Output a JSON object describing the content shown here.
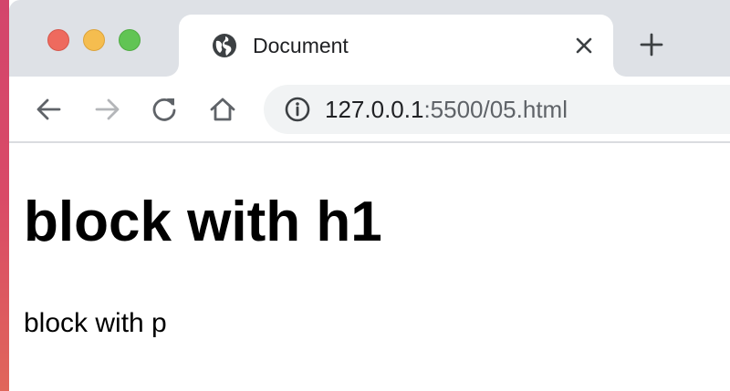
{
  "tab": {
    "title": "Document",
    "favicon": "globe-icon"
  },
  "toolbar": {
    "back_icon": "arrow-left-icon",
    "forward_icon": "arrow-right-icon",
    "reload_icon": "reload-icon",
    "home_icon": "home-icon",
    "info_icon": "info-icon",
    "new_tab_icon": "plus-icon",
    "close_tab_icon": "close-icon"
  },
  "address": {
    "host": "127.0.0.1",
    "path": ":5500/05.html"
  },
  "page": {
    "heading": "block with h1",
    "paragraph": "block with p"
  },
  "colors": {
    "tabstrip_bg": "#dee1e6",
    "omnibox_bg": "#f1f3f4",
    "close_red": "#ee6a5e",
    "minimize_yellow": "#f5bd4f",
    "zoom_green": "#61c454",
    "forward_disabled": "#b4b6b9"
  }
}
